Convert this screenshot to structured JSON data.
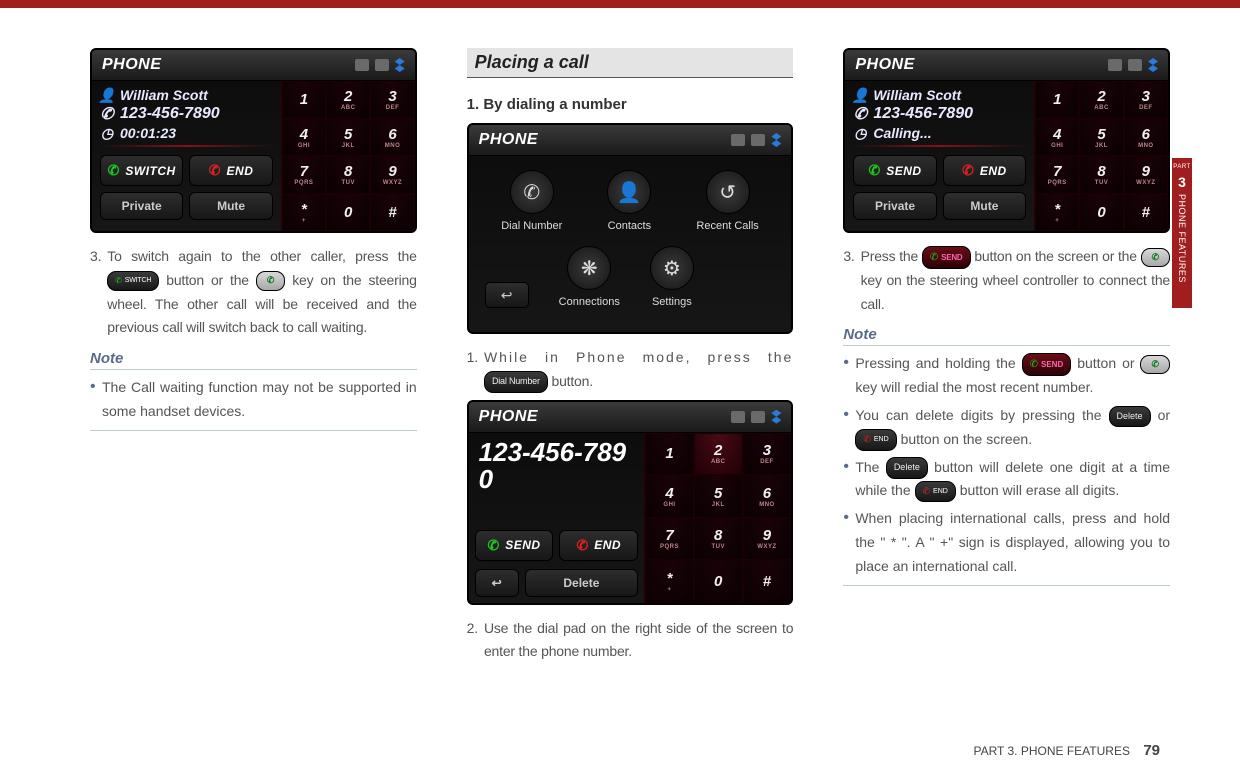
{
  "footer": {
    "part": "PART 3. PHONE FEATURES",
    "page": "79"
  },
  "side_tab": {
    "part_label": "PART",
    "num": "3",
    "title": "PHONE FEATURES"
  },
  "pills": {
    "switch": "SWITCH",
    "send": "SEND",
    "end": "END",
    "delete": "Delete",
    "dial_number": "Dial Number"
  },
  "keypad": {
    "1": {
      "d": "1",
      "sub": ""
    },
    "2": {
      "d": "2",
      "sub": "ABC"
    },
    "3": {
      "d": "3",
      "sub": "DEF"
    },
    "4": {
      "d": "4",
      "sub": "GHI"
    },
    "5": {
      "d": "5",
      "sub": "JKL"
    },
    "6": {
      "d": "6",
      "sub": "MNO"
    },
    "7": {
      "d": "7",
      "sub": "PQRS"
    },
    "8": {
      "d": "8",
      "sub": "TUV"
    },
    "9": {
      "d": "9",
      "sub": "WXYZ"
    },
    "star": {
      "d": "*",
      "sub": "+"
    },
    "0": {
      "d": "0",
      "sub": ""
    },
    "hash": {
      "d": "#",
      "sub": ""
    }
  },
  "col1": {
    "phone": {
      "title": "PHONE",
      "name": "William Scott",
      "number": "123-456-7890",
      "duration": "00:01:23",
      "btn_switch": "SWITCH",
      "btn_end": "END",
      "btn_priv": "Private",
      "btn_mute": "Mute"
    },
    "step3_a": "To switch again to the other caller, press the ",
    "step3_b": " button or the ",
    "step3_c": " key on the steering wheel. The other call will be received and the previous call will switch back to call waiting.",
    "note_h": "Note",
    "note1": "The Call waiting function may not be supported in some handset devices."
  },
  "col2": {
    "heading": "Placing a call",
    "sub1": "1. By dialing a number",
    "menu_phone": {
      "title": "PHONE",
      "items": [
        "Dial Number",
        "Contacts",
        "Recent Calls",
        "Connections",
        "Settings"
      ]
    },
    "step1_a": "While in Phone mode, press the ",
    "step1_b": " button.",
    "dial_phone": {
      "title": "PHONE",
      "dialed": "123-456-7890",
      "btn_send": "SEND",
      "btn_end": "END",
      "btn_back": "↩",
      "btn_delete": "Delete"
    },
    "step2": "Use the dial pad on the right side of the screen to enter the phone number."
  },
  "col3": {
    "phone": {
      "title": "PHONE",
      "name": "William Scott",
      "number": "123-456-7890",
      "state": "Calling...",
      "btn_send": "SEND",
      "btn_end": "END",
      "btn_priv": "Private",
      "btn_mute": "Mute"
    },
    "step3_a": "Press the ",
    "step3_b": " button on the screen or the ",
    "step3_c": " key on the steering wheel controller to connect the call.",
    "note_h": "Note",
    "n1_a": "Pressing and holding the ",
    "n1_b": " button or ",
    "n1_c": " key will redial the most recent number.",
    "n2_a": "You can delete digits by pressing the ",
    "n2_b": " or ",
    "n2_c": " button on the screen.",
    "n3_a": "The ",
    "n3_b": " button will delete one digit at a time while the ",
    "n3_c": " button will erase all digits.",
    "n4": "When placing international calls, press and hold the \" * \". A \" +\" sign is displayed, allowing you to place an international call."
  }
}
